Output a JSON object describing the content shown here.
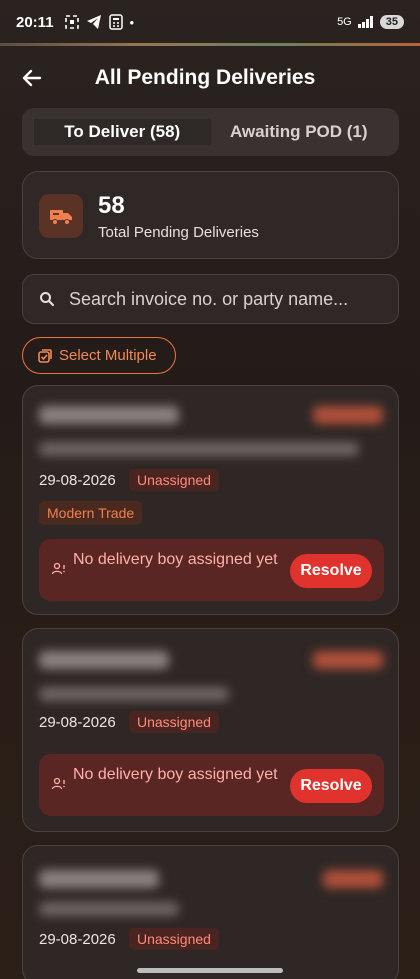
{
  "status_bar": {
    "time": "20:11",
    "network": "5G",
    "battery": "35",
    "icons": [
      "screenshot-icon",
      "telegram-icon",
      "calculator-icon",
      "dot-icon",
      "signal-icon",
      "battery-icon"
    ]
  },
  "header": {
    "title": "All Pending Deliveries",
    "back_icon": "arrow-left-icon"
  },
  "tabs": [
    {
      "label": "To Deliver (58)",
      "active": true
    },
    {
      "label": "Awaiting POD (1)",
      "active": false
    }
  ],
  "summary": {
    "count": "58",
    "label": "Total Pending Deliveries",
    "icon": "truck-icon"
  },
  "search": {
    "placeholder": "Search invoice no. or party name...",
    "value": ""
  },
  "select_multiple": {
    "label": "Select Multiple",
    "icon": "checklist-icon"
  },
  "cards": [
    {
      "date": "29-08-2026",
      "status": "Unassigned",
      "tag": "Modern Trade",
      "alert_text": "No delivery boy assigned yet",
      "action_label": "Resolve"
    },
    {
      "date": "29-08-2026",
      "status": "Unassigned",
      "alert_text": "No delivery boy assigned yet",
      "action_label": "Resolve"
    },
    {
      "date": "29-08-2026",
      "status": "Unassigned"
    }
  ],
  "colors": {
    "accent": "#e8763f",
    "danger": "#e0332e",
    "card_bg": "#2e2725"
  }
}
